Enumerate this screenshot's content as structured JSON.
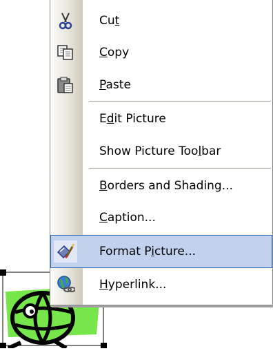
{
  "context_menu": {
    "items": [
      {
        "pre": "Cu",
        "key": "t",
        "post": "",
        "icon": "scissors-icon"
      },
      {
        "pre": "",
        "key": "C",
        "post": "opy",
        "icon": "copy-icon"
      },
      {
        "pre": "",
        "key": "P",
        "post": "aste",
        "icon": "paste-icon"
      },
      {
        "pre": "E",
        "key": "d",
        "post": "it Picture",
        "icon": ""
      },
      {
        "pre": "Show Picture Too",
        "key": "l",
        "post": "bar",
        "icon": ""
      },
      {
        "pre": "",
        "key": "B",
        "post": "orders and Shading...",
        "icon": ""
      },
      {
        "pre": "",
        "key": "C",
        "post": "aption...",
        "icon": ""
      },
      {
        "pre": "Format P",
        "key": "i",
        "post": "cture...",
        "icon": "format-picture-icon"
      },
      {
        "pre": "",
        "key": "H",
        "post": "yperlink...",
        "icon": "hyperlink-icon"
      }
    ]
  },
  "colors": {
    "highlight_fill": "#c1d2ee",
    "highlight_border": "#316ac5",
    "clipart_green": "#77e64a"
  }
}
